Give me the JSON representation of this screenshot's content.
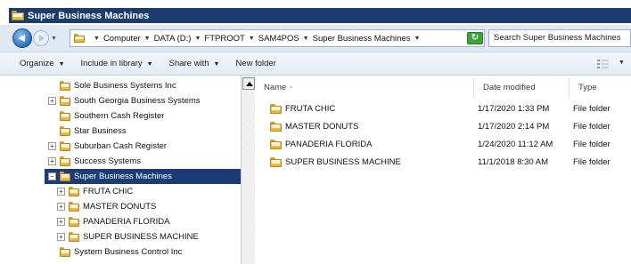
{
  "window": {
    "title": "Super Business Machines"
  },
  "address": {
    "crumbs": [
      "Computer",
      "DATA (D:)",
      "FTPROOT",
      "SAM4POS",
      "Super Business Machines"
    ],
    "search_placeholder": "Search Super Business Machines"
  },
  "toolbar": {
    "organize": "Organize",
    "include_in_library": "Include in library",
    "share_with": "Share with",
    "new_folder": "New folder"
  },
  "nav": {
    "items": [
      {
        "label": "Sole Business Systems Inc",
        "expandable": false,
        "selected": false
      },
      {
        "label": "South Georgia Business Systems",
        "expandable": true,
        "selected": false
      },
      {
        "label": "Southern Cash Register",
        "expandable": false,
        "selected": false
      },
      {
        "label": "Star Business",
        "expandable": false,
        "selected": false
      },
      {
        "label": "Suburban Cash Register",
        "expandable": true,
        "selected": false
      },
      {
        "label": "Success Systems",
        "expandable": true,
        "selected": false
      },
      {
        "label": "Super Business Machines",
        "expandable": true,
        "selected": true,
        "expanded": true
      },
      {
        "label": "FRUTA CHIC",
        "expandable": true,
        "selected": false,
        "child": true
      },
      {
        "label": "MASTER DONUTS",
        "expandable": true,
        "selected": false,
        "child": true
      },
      {
        "label": "PANADERIA FLORIDA",
        "expandable": true,
        "selected": false,
        "child": true
      },
      {
        "label": "SUPER BUSINESS MACHINE",
        "expandable": true,
        "selected": false,
        "child": true
      },
      {
        "label": "System Business Control Inc",
        "expandable": false,
        "selected": false
      }
    ]
  },
  "details": {
    "columns": {
      "name": "Name",
      "date_modified": "Date modified",
      "type": "Type"
    },
    "rows": [
      {
        "name": "FRUTA CHIC",
        "date": "1/17/2020 1:33 PM",
        "type": "File folder"
      },
      {
        "name": "MASTER DONUTS",
        "date": "1/17/2020 2:14 PM",
        "type": "File folder"
      },
      {
        "name": "PANADERIA FLORIDA",
        "date": "1/24/2020 11:12 AM",
        "type": "File folder"
      },
      {
        "name": "SUPER BUSINESS MACHINE",
        "date": "11/1/2018 8:30 AM",
        "type": "File folder"
      }
    ]
  },
  "icons": {
    "folder": "folder-icon",
    "back": "back-arrow-icon",
    "forward": "forward-arrow-icon",
    "refresh": "refresh-icon",
    "view": "view-options-icon"
  },
  "colors": {
    "title_bar": "#1c3b6f",
    "selection": "#1b3c76",
    "folder": "#e2b03a"
  }
}
